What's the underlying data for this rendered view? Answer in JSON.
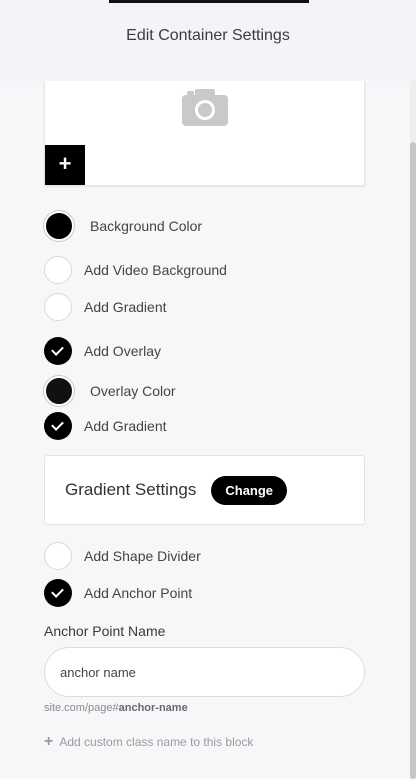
{
  "header": {
    "title": "Edit Container Settings"
  },
  "image_block": {
    "icon": "camera-icon",
    "add_label": "+"
  },
  "options": {
    "background_color": {
      "label": "Background Color",
      "color": "#000000"
    },
    "video_background": {
      "label": "Add Video Background",
      "checked": false
    },
    "gradient_1": {
      "label": "Add Gradient",
      "checked": false
    },
    "overlay": {
      "label": "Add Overlay",
      "checked": true
    },
    "overlay_color": {
      "label": "Overlay Color",
      "color": "#111111"
    },
    "gradient_2": {
      "label": "Add Gradient",
      "checked": true
    },
    "shape_divider": {
      "label": "Add Shape Divider",
      "checked": false
    },
    "anchor_point": {
      "label": "Add Anchor Point",
      "checked": true
    }
  },
  "gradient_settings": {
    "title": "Gradient Settings",
    "change_label": "Change"
  },
  "anchor": {
    "field_label": "Anchor Point Name",
    "value": "anchor name",
    "url_prefix": "site.com/page#",
    "url_anchor": "anchor-name"
  },
  "add_class": {
    "label": "Add custom class name to this block"
  }
}
